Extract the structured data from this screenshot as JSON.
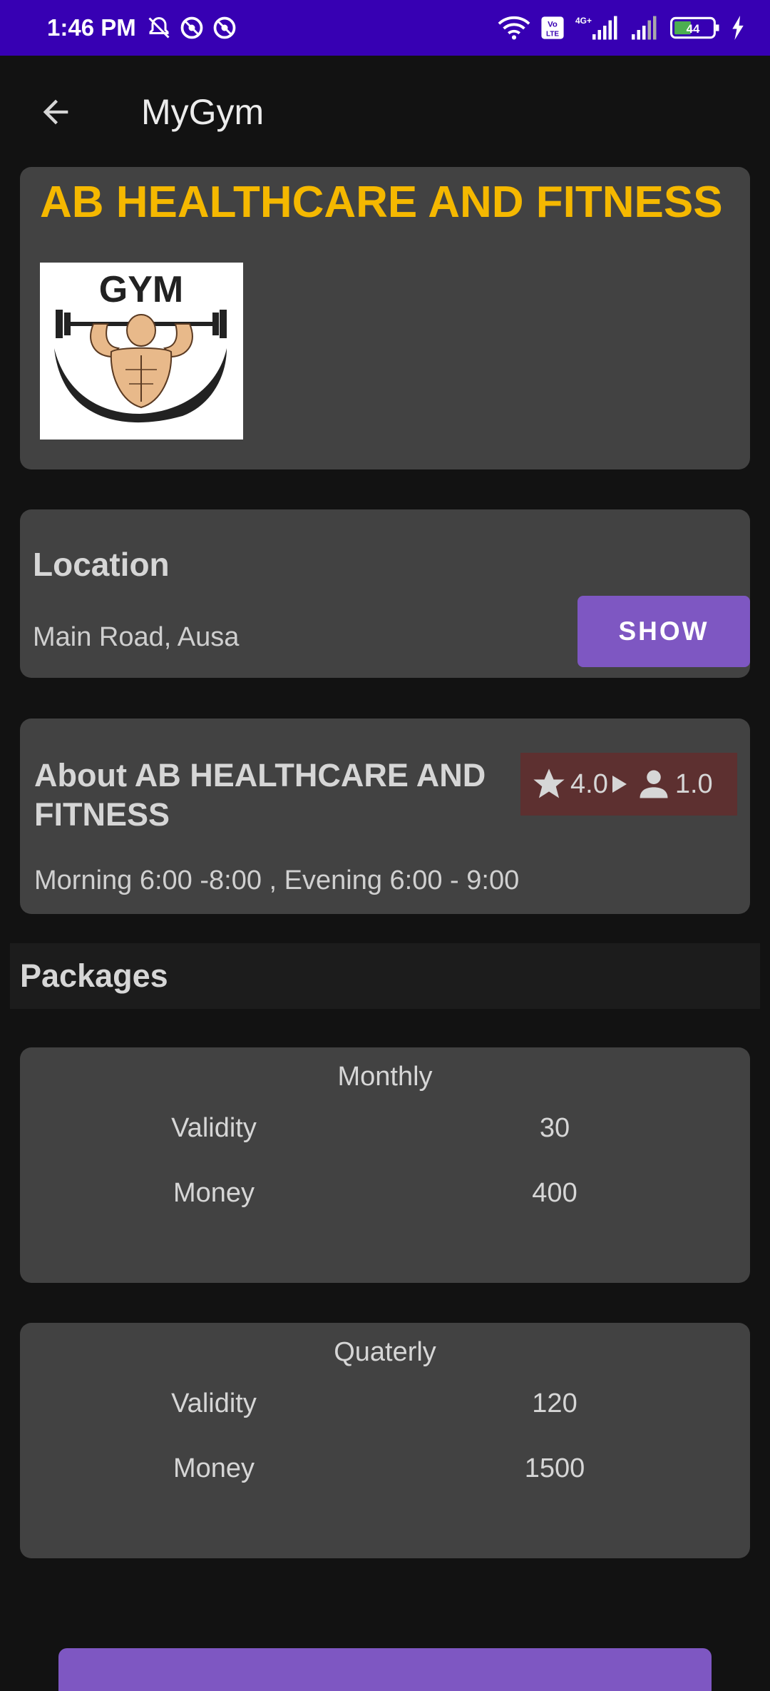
{
  "status_bar": {
    "time": "1:46 PM",
    "battery": "44",
    "network_label": "4G+",
    "volte_label": "Vo LTE"
  },
  "app_bar": {
    "title": "MyGym"
  },
  "gym": {
    "name": "AB HEALTHCARE AND FITNESS",
    "logo_text": "GYM"
  },
  "location": {
    "title": "Location",
    "address": "Main Road, Ausa",
    "show_label": "SHOW"
  },
  "about": {
    "title": "About AB HEALTHCARE AND FITNESS",
    "hours": "Morning 6:00 -8:00 , Evening 6:00 - 9:00",
    "rating": "4.0",
    "count": "1.0"
  },
  "packages": {
    "header": "Packages",
    "items": [
      {
        "name": "Monthly",
        "validity_label": "Validity",
        "validity": "30",
        "money_label": "Money",
        "money": "400"
      },
      {
        "name": "Quaterly",
        "validity_label": "Validity",
        "validity": "120",
        "money_label": "Money",
        "money": "1500"
      }
    ]
  },
  "colors": {
    "status_bar": "#3700b3",
    "accent": "#7e57c2",
    "gym_name": "#f5b800",
    "card": "#424242",
    "rating_bg": "#5d3030"
  }
}
